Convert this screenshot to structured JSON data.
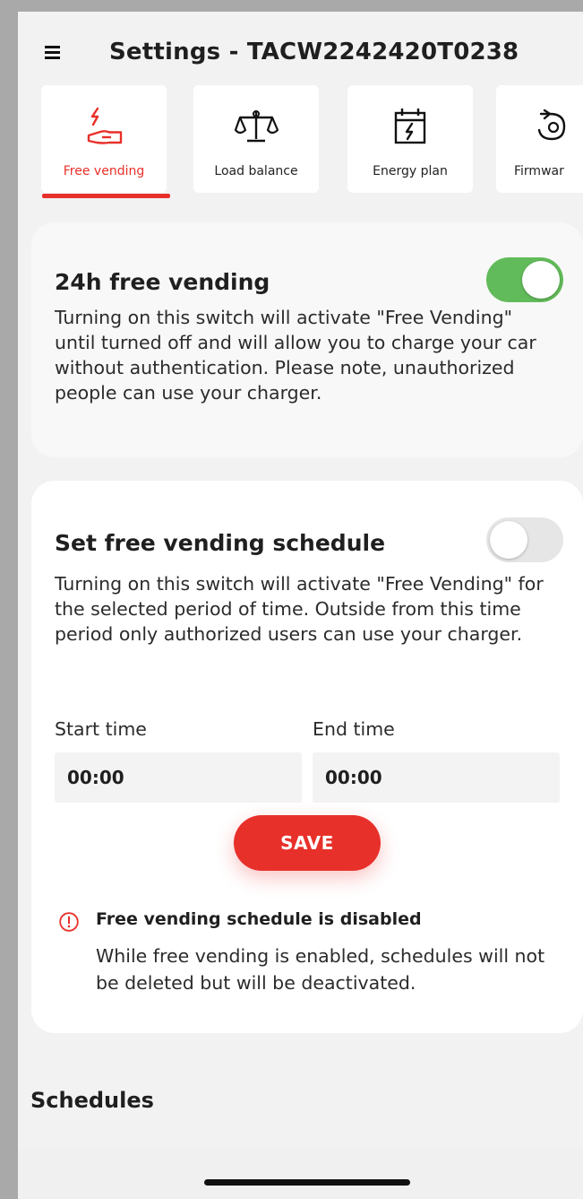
{
  "header": {
    "title": "Settings - TACW2242420T0238"
  },
  "tabs": [
    {
      "label": "Free vending",
      "icon": "free-vending-icon",
      "active": true
    },
    {
      "label": "Load balance",
      "icon": "scale-icon",
      "active": false
    },
    {
      "label": "Energy plan",
      "icon": "calendar-bolt-icon",
      "active": false
    },
    {
      "label": "Firmwar",
      "icon": "firmware-icon",
      "active": false
    }
  ],
  "free_vending": {
    "title": "24h free vending",
    "description": "Turning on this switch will activate \"Free Vending\" until turned off and will allow you to charge your car without authentication. Please note, unauthorized people can use your charger.",
    "enabled": true
  },
  "schedule": {
    "title": "Set free vending schedule",
    "description": "Turning on this switch will activate \"Free Vending\" for the selected period of time. Outside from this time period only authorized users can use your charger.",
    "enabled": false,
    "start_label": "Start time",
    "end_label": "End time",
    "start_value": "00:00",
    "end_value": "00:00",
    "save_label": "SAVE",
    "warning_title": "Free vending schedule is disabled",
    "warning_text": "While free vending is enabled, schedules will not be deleted but will be deactivated."
  },
  "schedules_section": {
    "title": "Schedules"
  },
  "colors": {
    "accent": "#e8302a",
    "toggle_on": "#62bb5a",
    "background": "#f2f2f2"
  }
}
